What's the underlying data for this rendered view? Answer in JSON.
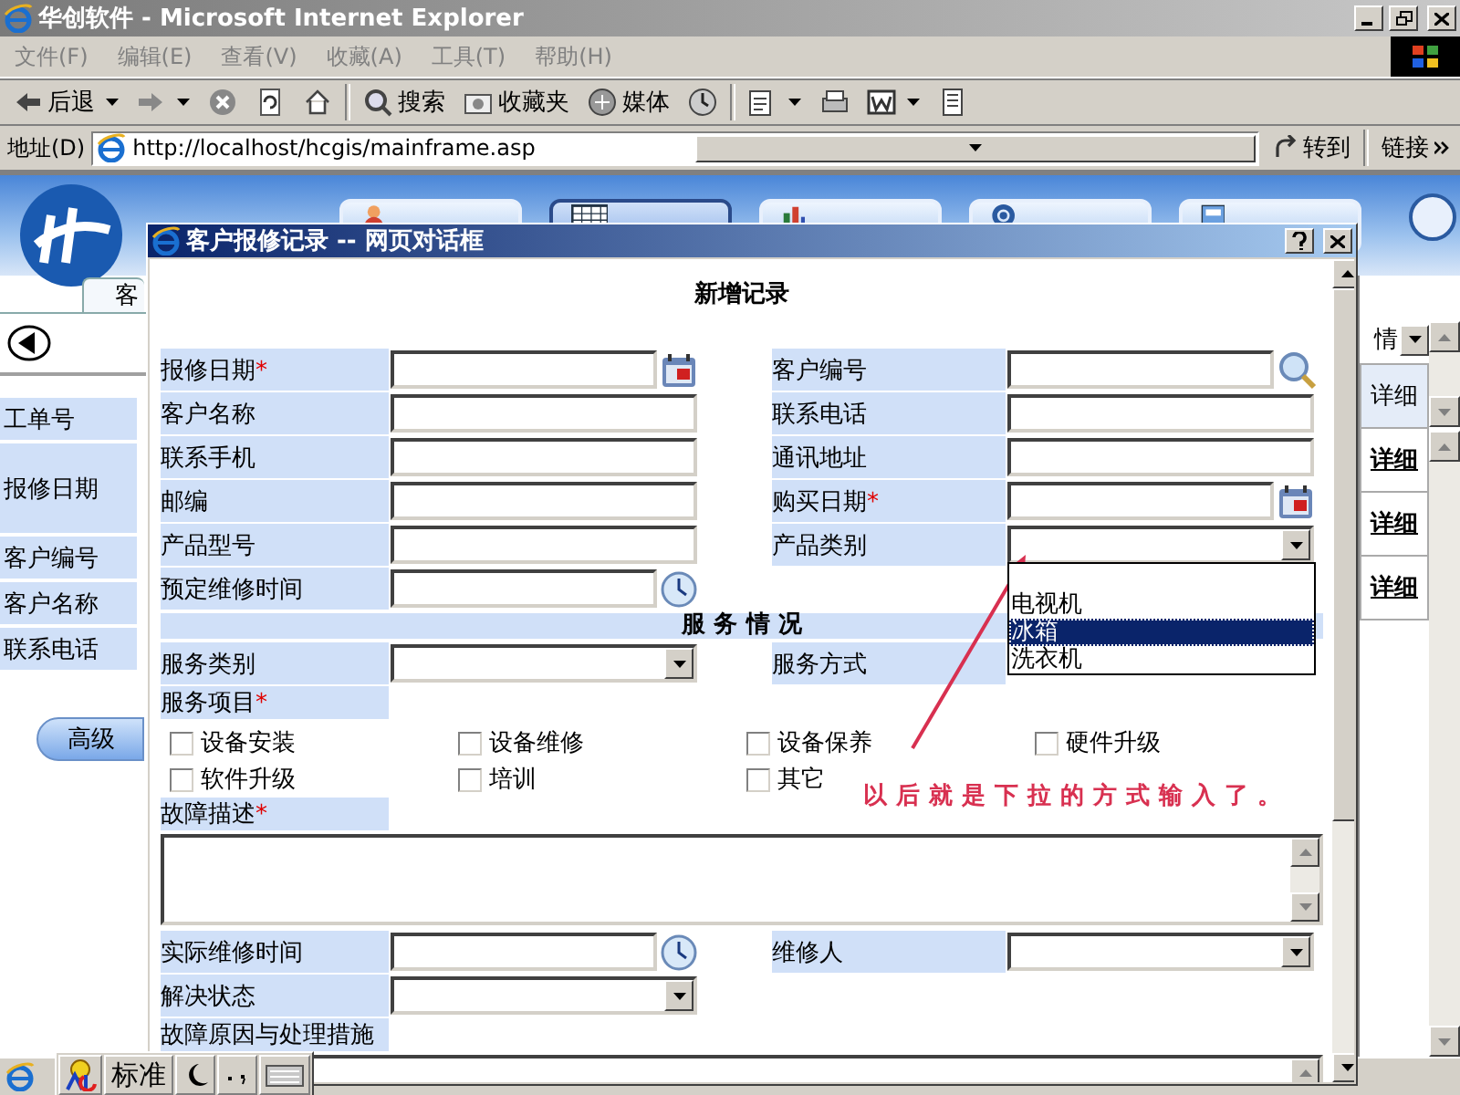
{
  "window": {
    "title": "华创软件 - Microsoft Internet Explorer"
  },
  "menu": [
    {
      "label": "文件(F)",
      "disabled": true
    },
    {
      "label": "编辑(E)",
      "disabled": true
    },
    {
      "label": "查看(V)",
      "disabled": true
    },
    {
      "label": "收藏(A)",
      "disabled": true
    },
    {
      "label": "工具(T)",
      "disabled": true
    },
    {
      "label": "帮助(H)",
      "disabled": true
    }
  ],
  "toolbar": [
    {
      "kind": "back",
      "label": "后退",
      "dropdown": true
    },
    {
      "kind": "forward",
      "dropdown": true
    },
    {
      "kind": "stop",
      "dropdown": false
    },
    {
      "kind": "refresh",
      "dropdown": false
    },
    {
      "kind": "home",
      "dropdown": false
    },
    {
      "kind": "search",
      "label": "搜索",
      "dropdown": false
    },
    {
      "kind": "favorites",
      "label": "收藏夹",
      "dropdown": false
    },
    {
      "kind": "media",
      "label": "媒体",
      "dropdown": false
    },
    {
      "kind": "history",
      "dropdown": false
    },
    {
      "kind": "mail",
      "dropdown": true
    },
    {
      "kind": "print",
      "dropdown": false
    },
    {
      "kind": "word",
      "dropdown": true
    },
    {
      "kind": "edit",
      "dropdown": false
    }
  ],
  "address": {
    "label": "地址(D)",
    "value": "http://localhost/hcgis/mainframe.asp",
    "go": "转到",
    "links": "链接"
  },
  "app": {
    "nav": [
      {
        "kind": "person",
        "selected": false
      },
      {
        "kind": "table",
        "selected": true
      },
      {
        "kind": "chart",
        "selected": false
      },
      {
        "kind": "gear",
        "selected": false
      },
      {
        "kind": "exit",
        "selected": false
      }
    ],
    "tab": "客",
    "search_labels": [
      "工单号",
      "报修日期",
      "客户编号",
      "客户名称",
      "联系电话"
    ],
    "advanced_button": "高级",
    "view_select": "情",
    "column": "详细",
    "row_links": [
      "详细",
      "详细",
      "详细"
    ]
  },
  "dialog": {
    "title": "客户报修记录 -- 网页对话框",
    "heading": "新增记录",
    "form": [
      {
        "kind": "pair",
        "cells": [
          {
            "label": "报修日期",
            "required_mark": "*",
            "kind": "date"
          },
          {
            "label": "客户编号",
            "kind": "lookup"
          }
        ]
      },
      {
        "kind": "pair",
        "cells": [
          {
            "label": "客户名称",
            "kind": "text"
          },
          {
            "label": "联系电话",
            "kind": "text"
          }
        ]
      },
      {
        "kind": "pair",
        "cells": [
          {
            "label": "联系手机",
            "kind": "text"
          },
          {
            "label": "通讯地址",
            "kind": "text"
          }
        ]
      },
      {
        "kind": "pair",
        "cells": [
          {
            "label": "邮编",
            "kind": "text"
          },
          {
            "label": "购买日期",
            "required_mark": "*",
            "kind": "date"
          }
        ]
      },
      {
        "kind": "pair",
        "cells": [
          {
            "label": "产品型号",
            "kind": "text"
          },
          {
            "label": "产品类别",
            "kind": "select",
            "open": true,
            "options": [
              {
                "label": "电视机",
                "selected": false
              },
              {
                "label": "冰箱",
                "selected": true
              },
              {
                "label": "洗衣机",
                "selected": false
              }
            ]
          }
        ]
      },
      {
        "kind": "pair",
        "cells": [
          {
            "label": "预定维修时间",
            "kind": "time"
          }
        ]
      },
      {
        "kind": "section",
        "label": "服 务 情 况"
      },
      {
        "kind": "pair",
        "cells": [
          {
            "label": "服务类别",
            "kind": "select",
            "open": false
          },
          {
            "label": "服务方式"
          }
        ]
      },
      {
        "kind": "label",
        "label": "服务项目",
        "required_mark": "*"
      },
      {
        "kind": "checks",
        "items": [
          {
            "label": "设备安装",
            "checked": false
          },
          {
            "label": "设备维修",
            "checked": false
          },
          {
            "label": "设备保养",
            "checked": false
          },
          {
            "label": "硬件升级",
            "checked": false
          },
          {
            "label": "软件升级",
            "checked": false
          },
          {
            "label": "培训",
            "checked": false
          },
          {
            "label": "其它",
            "checked": false
          }
        ]
      },
      {
        "kind": "label",
        "label": "故障描述",
        "required_mark": "*"
      },
      {
        "kind": "textarea"
      },
      {
        "kind": "pair",
        "cells": [
          {
            "label": "实际维修时间",
            "kind": "time"
          },
          {
            "label": "维修人",
            "kind": "select",
            "open": false
          }
        ]
      },
      {
        "kind": "pair",
        "cells": [
          {
            "label": "解决状态",
            "kind": "select",
            "open": false
          }
        ]
      },
      {
        "kind": "label",
        "label": "故障原因与处理措施"
      },
      {
        "kind": "textarea"
      }
    ]
  },
  "annotation": {
    "text": "以后就是下拉的方式输入了。"
  },
  "ime": {
    "mode": "标准"
  }
}
